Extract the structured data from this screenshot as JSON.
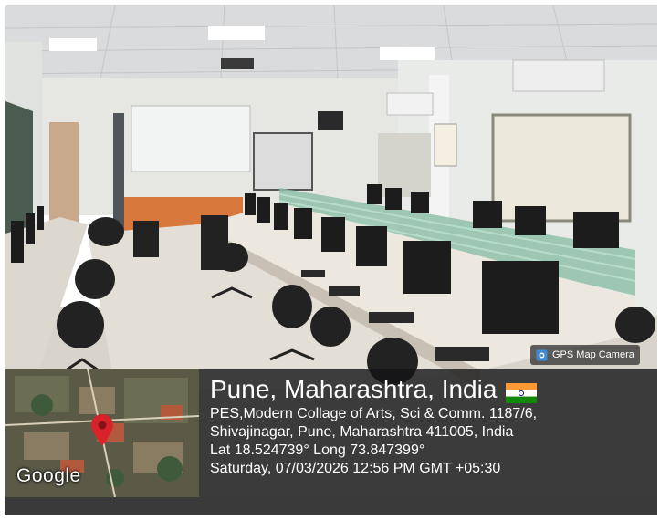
{
  "overlay": {
    "badge_label": "GPS Map Camera",
    "badge_icon": "camera-icon",
    "location_title": "Pune, Maharashtra, India",
    "address_line_1": "PES,Modern Collage of Arts, Sci & Comm. 1187/6,",
    "address_line_2": "Shivajinagar, Pune, Maharashtra 411005, India",
    "coordinates": "Lat 18.524739° Long 73.847399°",
    "timestamp": "Saturday, 07/03/2026 12:56 PM GMT +05:30",
    "map_logo": "Google",
    "flag_icon": "india-flag-icon",
    "pin_icon": "map-pin-icon",
    "pin_color": "#d8232a",
    "panel_color": "#141416"
  }
}
